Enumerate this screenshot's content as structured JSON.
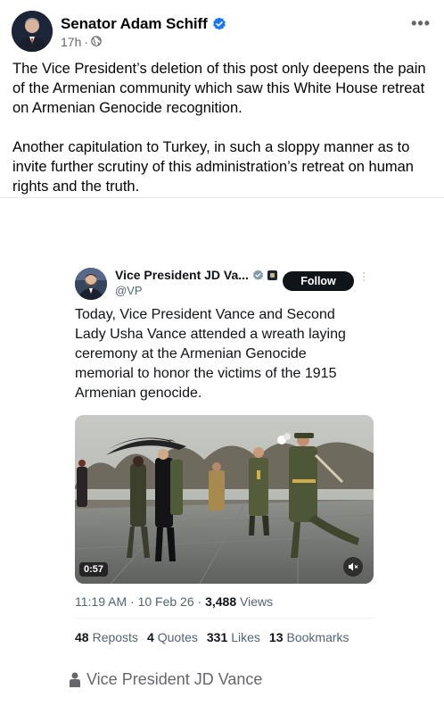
{
  "post": {
    "author": "Senator Adam Schiff",
    "time": "17h",
    "separator": "·",
    "paragraph_1": "The Vice President’s deletion of this post only deepens the pain of the Armenian community which saw this White House retreat on Armenian Genocide recognition.",
    "paragraph_2": "Another capitulation to Turkey, in such a sloppy manner as to invite further scrutiny of this administration’s retreat on human rights and the truth.",
    "more_icon": "more-horizontal-icon",
    "privacy_icon": "globe-icon",
    "verified_color": "#1877f2"
  },
  "tweet": {
    "name": "Vice President JD Va...",
    "handle": "@VP",
    "follow_label": "Follow",
    "text": "Today, Vice President Vance and Second Lady Usha Vance attended a wreath laying ceremony at the Armenian Genocide memorial to honor the victims of the 1915 Armenian genocide.",
    "video_duration": "0:57",
    "time": "11:19 AM",
    "date": "10 Feb 26",
    "views_count": "3,488",
    "views_label": "Views",
    "stats": [
      {
        "count": "48",
        "label": "Reposts"
      },
      {
        "count": "4",
        "label": "Quotes"
      },
      {
        "count": "331",
        "label": "Likes"
      },
      {
        "count": "13",
        "label": "Bookmarks"
      }
    ]
  },
  "attribution": {
    "text": "Vice President JD Vance",
    "icon": "person-icon"
  }
}
